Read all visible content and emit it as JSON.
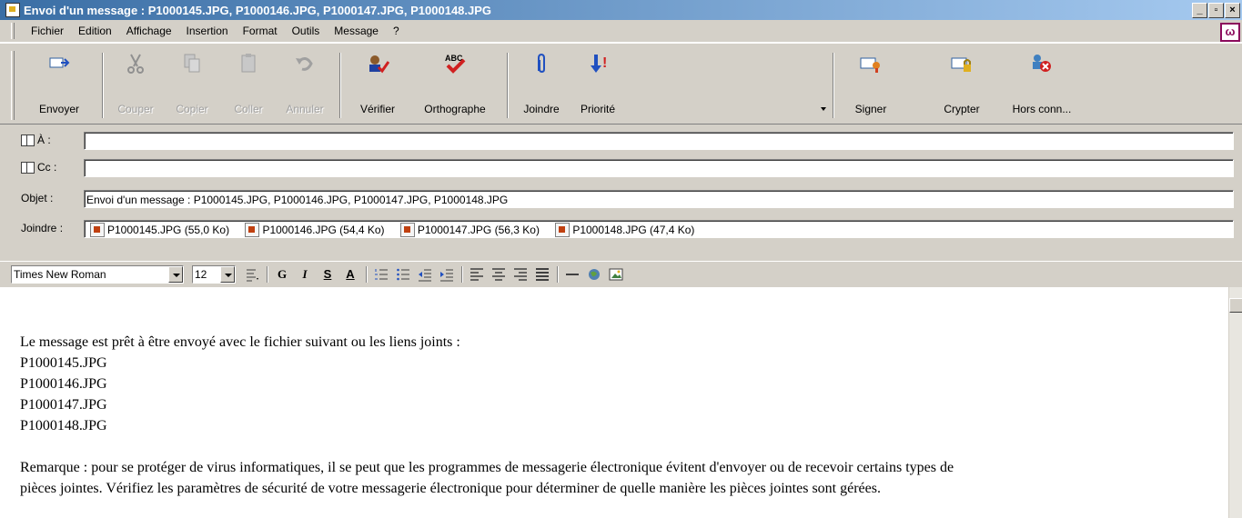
{
  "window": {
    "title": "Envoi d'un message : P1000145.JPG, P1000146.JPG, P1000147.JPG, P1000148.JPG",
    "minimize_glyph": "_",
    "maximize_glyph": "▫",
    "close_glyph": "×"
  },
  "menu": [
    "Fichier",
    "Edition",
    "Affichage",
    "Insertion",
    "Format",
    "Outils",
    "Message",
    "?"
  ],
  "brand_letter": "ω",
  "toolbar": {
    "send": "Envoyer",
    "cut": "Couper",
    "copy": "Copier",
    "paste": "Coller",
    "undo": "Annuler",
    "check": "Vérifier",
    "spelling": "Orthographe",
    "attach": "Joindre",
    "priority": "Priorité",
    "sign": "Signer",
    "encrypt": "Crypter",
    "offline": "Hors conn...",
    "spelling_icon_text": "ABC",
    "priority_icon_text": "!"
  },
  "header": {
    "to_label": "À :",
    "to_value": "",
    "cc_label": "Cc :",
    "cc_value": "",
    "subject_label": "Objet :",
    "subject_value": "Envoi d'un message : P1000145.JPG, P1000146.JPG, P1000147.JPG, P1000148.JPG",
    "attach_label": "Joindre :",
    "attachments": [
      "P1000145.JPG (55,0 Ko)",
      "P1000146.JPG (54,4 Ko)",
      "P1000147.JPG (56,3 Ko)",
      "P1000148.JPG (47,4 Ko)"
    ]
  },
  "format": {
    "font": "Times New Roman",
    "size": "12",
    "bold": "G",
    "italic": "I",
    "underline": "S",
    "color": "A"
  },
  "body": {
    "intro": "Le message est prêt à être envoyé avec le fichier suivant ou les liens joints :",
    "files": [
      "P1000145.JPG",
      "P1000146.JPG",
      "P1000147.JPG",
      "P1000148.JPG"
    ],
    "remark_line1": "Remarque : pour se protéger de virus informatiques, il se peut que les programmes de messagerie électronique évitent d'envoyer ou de recevoir certains types de",
    "remark_line2": "pièces jointes. Vérifiez les paramètres de sécurité de votre messagerie électronique pour déterminer de quelle manière les pièces jointes sont gérées."
  },
  "colors": {
    "titlebar_start": "#3A6EA5",
    "face": "#D4D0C8",
    "brand": "#8B0A5C"
  }
}
